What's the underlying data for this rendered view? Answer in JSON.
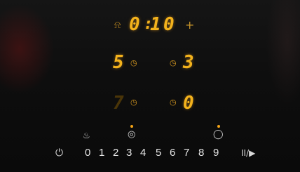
{
  "timer": {
    "digits": [
      "0",
      ":",
      "1",
      "0"
    ],
    "plus_label": "+"
  },
  "zones": {
    "front_left_level": "5",
    "front_right_level": "3",
    "rear_left_level": "7",
    "rear_right_level": "0"
  },
  "slider": {
    "levels": [
      "0",
      "1",
      "2",
      "3",
      "4",
      "5",
      "6",
      "7",
      "8",
      "9"
    ]
  },
  "icons": {
    "timer_bell": "bell-icon",
    "zone_timer": "clock-icon",
    "power": "power-icon",
    "keep_warm": "keep-warm-icon",
    "zone_select": "zone-select-icon",
    "bridge_zone": "bridge-zone-icon",
    "pause": "pause-play-icon"
  },
  "colors": {
    "display_amber": "#f3b21c",
    "dim_amber": "#4a3508",
    "indicator_dot": "#f4a416",
    "panel_black": "#0c0c0c",
    "touch_label": "#e6e6e6"
  }
}
